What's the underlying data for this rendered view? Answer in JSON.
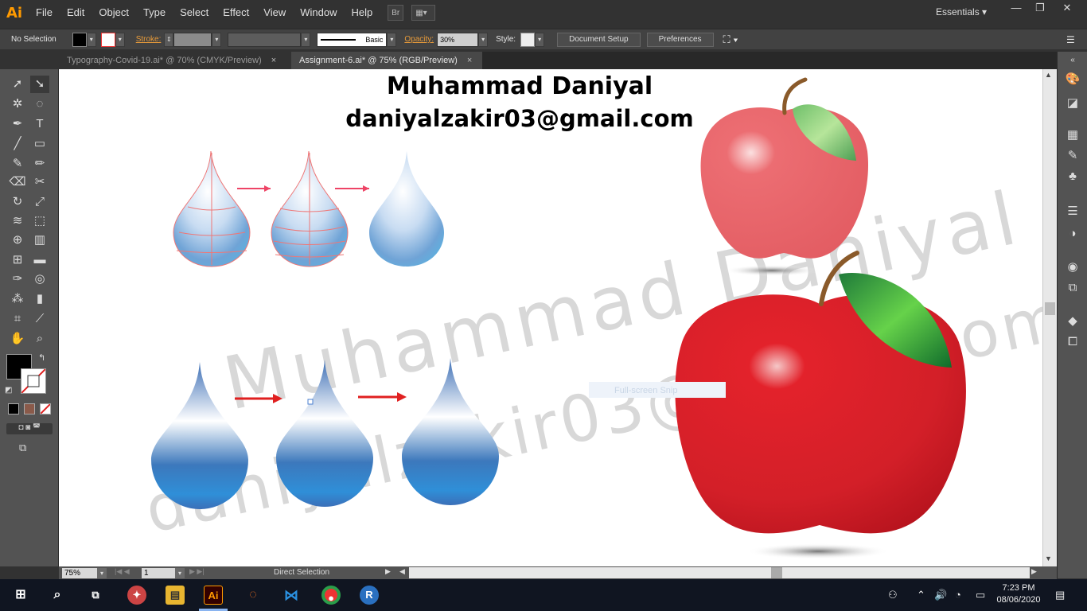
{
  "app": {
    "logo": "Ai",
    "menus": [
      "File",
      "Edit",
      "Object",
      "Type",
      "Select",
      "Effect",
      "View",
      "Window",
      "Help"
    ],
    "bridge_button": "Br",
    "workspace": "Essentials"
  },
  "control_bar": {
    "selection": "No Selection",
    "stroke_label": "Stroke:",
    "brush_label": "Basic",
    "opacity_label": "Opacity:",
    "opacity_value": "30%",
    "style_label": "Style:",
    "doc_setup": "Document Setup",
    "preferences": "Preferences"
  },
  "tabs": [
    {
      "label": "Typography-Covid-19.ai* @ 70% (CMYK/Preview)",
      "close": "×"
    },
    {
      "label": "Assignment-6.ai* @ 75% (RGB/Preview)",
      "close": "×"
    }
  ],
  "artwork": {
    "title": "Muhammad Daniyal",
    "email": "daniyalzakir03@gmail.com",
    "watermark_line1": "Muhammad Daniyal",
    "watermark_line2": "daniyalzakir03@gmail.com",
    "tooltip": "Full-screen Snip"
  },
  "status": {
    "zoom": "75%",
    "page": "1",
    "tool": "Direct Selection"
  },
  "taskbar": {
    "time": "7:23 PM",
    "date": "08/06/2020"
  },
  "colors": {
    "accent_orange": "#ff9a00",
    "apple_red": "#e0202a",
    "drop_blue": "#2f8fd8",
    "arrow_red": "#e02020"
  }
}
